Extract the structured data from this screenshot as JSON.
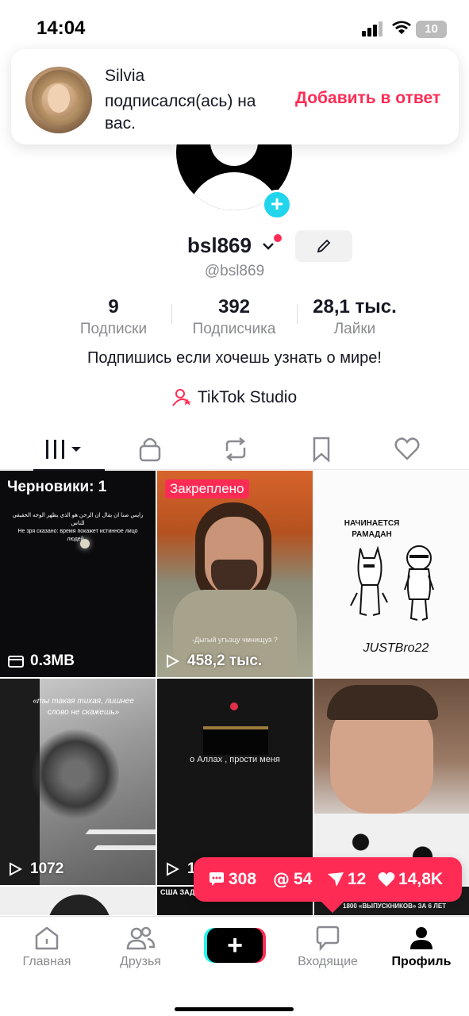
{
  "status_bar": {
    "time": "14:04",
    "battery": "10"
  },
  "notification": {
    "name": "Silvia",
    "text": "подписался(ась) на вас.",
    "action": "Добавить в ответ"
  },
  "profile": {
    "username": "bsl869",
    "handle": "@bsl869",
    "stats": [
      {
        "value": "9",
        "label": "Подписки"
      },
      {
        "value": "392",
        "label": "Подписчика"
      },
      {
        "value": "28,1 тыс.",
        "label": "Лайки"
      }
    ],
    "bio": "Подпишись если хочешь узнать о мире!",
    "studio_label": "TikTok Studio"
  },
  "tabs": [
    "videos-grid",
    "private",
    "reposts",
    "favorites",
    "liked"
  ],
  "grid": {
    "cells": [
      {
        "draft_label": "Черновики: 1",
        "meta": "0.3MB",
        "caption_ar": "رايس صنا ان يقال ان الرحن هو الذي يظهر الوجه الحقيقي للناس",
        "caption_ru": "Не зря сказано: время покажет истинное лицо людей..."
      },
      {
        "badge": "Закреплено",
        "meta": "458,2 тыс.",
        "caption": "-Дыгый угъэцу чмнищуэ ?"
      },
      {
        "title_line1": "НАЧИНАЕТСЯ",
        "title_line2": "РАМАДАН",
        "signature": "JUSTBro22"
      },
      {
        "meta": "1072",
        "caption": "«ты такая тихая, лишнее слово не скажешь»"
      },
      {
        "meta": "1",
        "caption": "о Аллах , прости меня"
      },
      {}
    ],
    "bottom_strip_1": "США ЗАДЕРЖАЛИ ...",
    "bottom_strip_2": "1800 «ВЫПУСКНИКОВ» ЗА 6 ЛЕТ"
  },
  "activity": {
    "comments": "308",
    "mentions": "54",
    "shares": "12",
    "likes": "14,8K"
  },
  "tabbar": {
    "home": "Главная",
    "friends": "Друзья",
    "inbox": "Входящие",
    "profile": "Профиль"
  },
  "colors": {
    "accent": "#fe2c55",
    "cyan": "#20d5ec"
  }
}
